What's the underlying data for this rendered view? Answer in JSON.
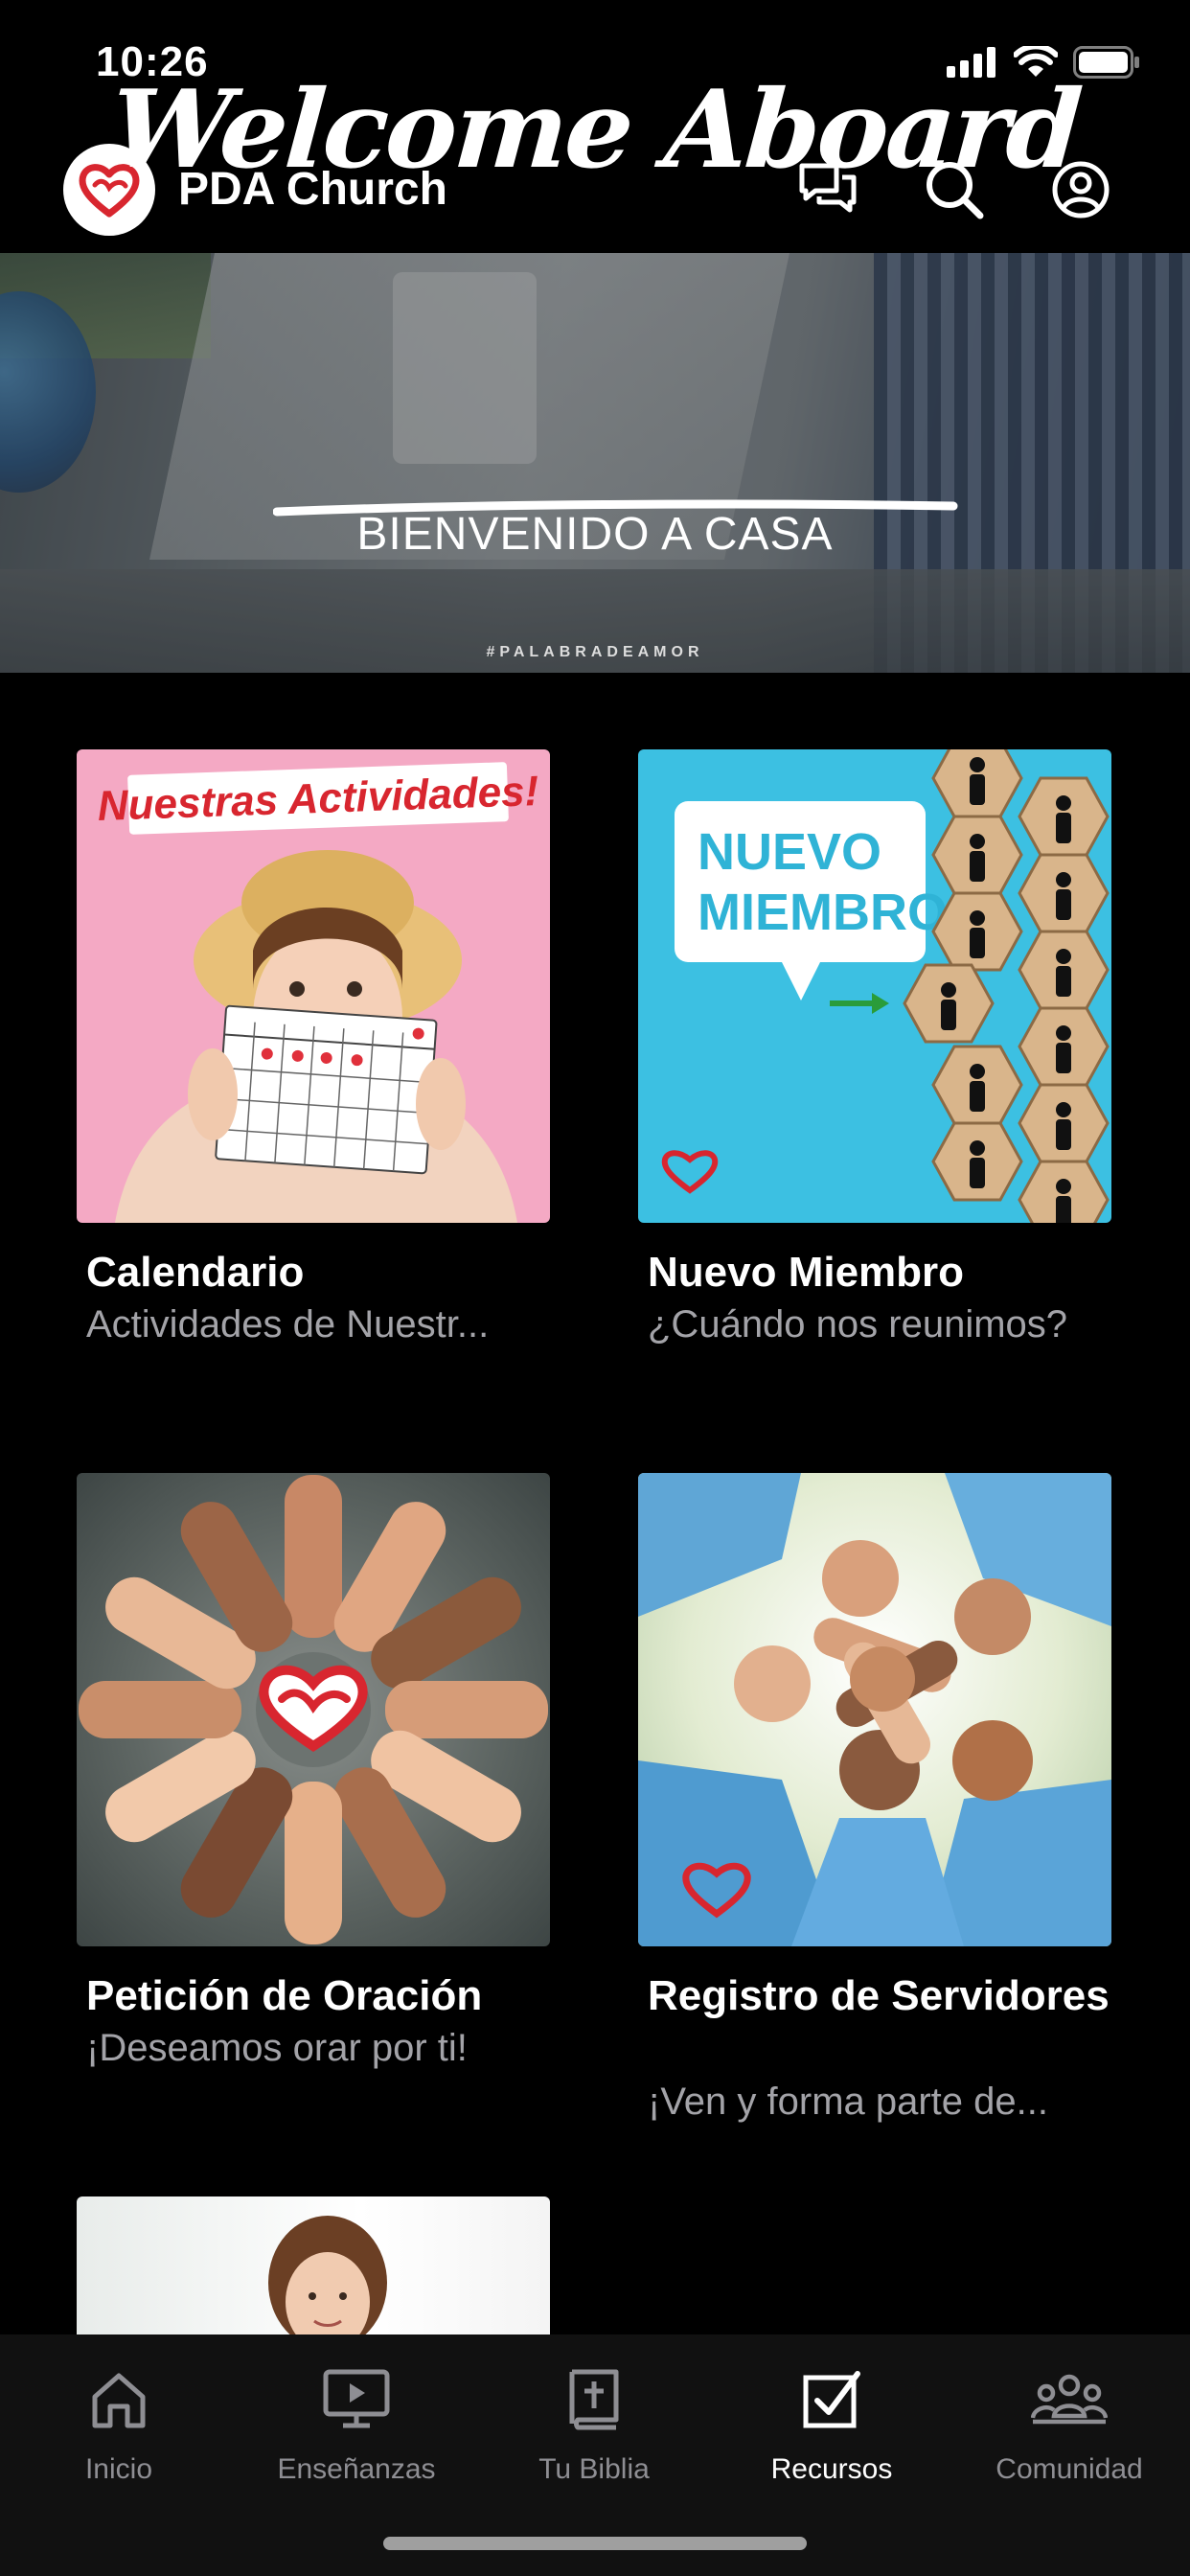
{
  "status_bar": {
    "time": "10:26"
  },
  "header": {
    "app_title": "PDA Church"
  },
  "banner": {
    "title": "Welcome Aboard",
    "subtitle": "BIENVENIDO A CASA",
    "hashtag": "#PALABRADEAMOR"
  },
  "cards": [
    {
      "title": "Calendario",
      "subtitle": "Actividades de Nuestr...",
      "image_text": "Nuestras Actividades!"
    },
    {
      "title": "Nuevo Miembro",
      "subtitle": "¿Cuándo nos reunimos?",
      "image_text": "NUEVO MIEMBRO"
    },
    {
      "title": "Petición de Oración",
      "subtitle": "¡Deseamos orar por ti!"
    },
    {
      "title": "Registro de Servidores",
      "subtitle": "¡Ven y forma parte de..."
    }
  ],
  "tabs": [
    {
      "label": "Inicio",
      "icon": "home-icon"
    },
    {
      "label": "Enseñanzas",
      "icon": "video-icon"
    },
    {
      "label": "Tu Biblia",
      "icon": "bible-icon"
    },
    {
      "label": "Recursos",
      "icon": "checkbox-icon"
    },
    {
      "label": "Comunidad",
      "icon": "community-icon"
    }
  ],
  "active_tab": "Recursos",
  "colors": {
    "brand_red": "#d8262f",
    "background": "#000000",
    "inactive_tab": "#8e8e93"
  }
}
